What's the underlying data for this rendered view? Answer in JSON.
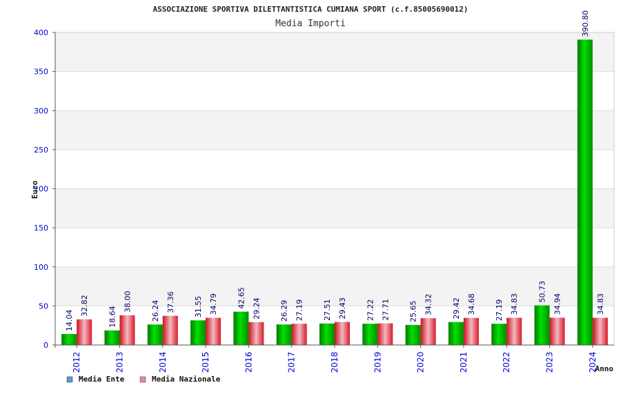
{
  "chart_data": {
    "type": "bar",
    "title": "ASSOCIAZIONE SPORTIVA DILETTANTISTICA CUMIANA SPORT (c.f.85005690012)",
    "subtitle": "Media Importi",
    "xlabel": "Anno",
    "ylabel": "Euro",
    "ylim": [
      0,
      400
    ],
    "yticks": [
      "0",
      "50",
      "100",
      "150",
      "200",
      "250",
      "300",
      "350",
      "400"
    ],
    "categories": [
      "2012",
      "2013",
      "2014",
      "2015",
      "2016",
      "2017",
      "2018",
      "2019",
      "2020",
      "2021",
      "2022",
      "2023",
      "2024"
    ],
    "series": [
      {
        "name": "Media Ente",
        "color": "#00cc00",
        "values": [
          14.04,
          18.64,
          26.24,
          31.55,
          42.65,
          26.29,
          27.51,
          27.22,
          25.65,
          29.42,
          27.19,
          50.73,
          390.8
        ],
        "labels": [
          "14.04",
          "18.64",
          "26.24",
          "31.55",
          "42.65",
          "26.29",
          "27.51",
          "27.22",
          "25.65",
          "29.42",
          "27.19",
          "50.73",
          "390.80"
        ]
      },
      {
        "name": "Media Nazionale",
        "color": "#e8203a",
        "values": [
          32.82,
          38.0,
          37.36,
          34.79,
          29.24,
          27.19,
          29.43,
          27.71,
          34.32,
          34.68,
          34.83,
          34.94,
          34.83
        ],
        "labels": [
          "32.82",
          "38.00",
          "37.36",
          "34.79",
          "29.24",
          "27.19",
          "29.43",
          "27.71",
          "34.32",
          "34.68",
          "34.83",
          "34.94",
          "34.83"
        ]
      }
    ],
    "legend": {
      "position": "bottom-left",
      "items": [
        {
          "label": "Media Ente",
          "swatch": "#5b9bd5"
        },
        {
          "label": "Media Nazionale",
          "swatch": "#e88aa8"
        }
      ]
    },
    "grid": true
  }
}
